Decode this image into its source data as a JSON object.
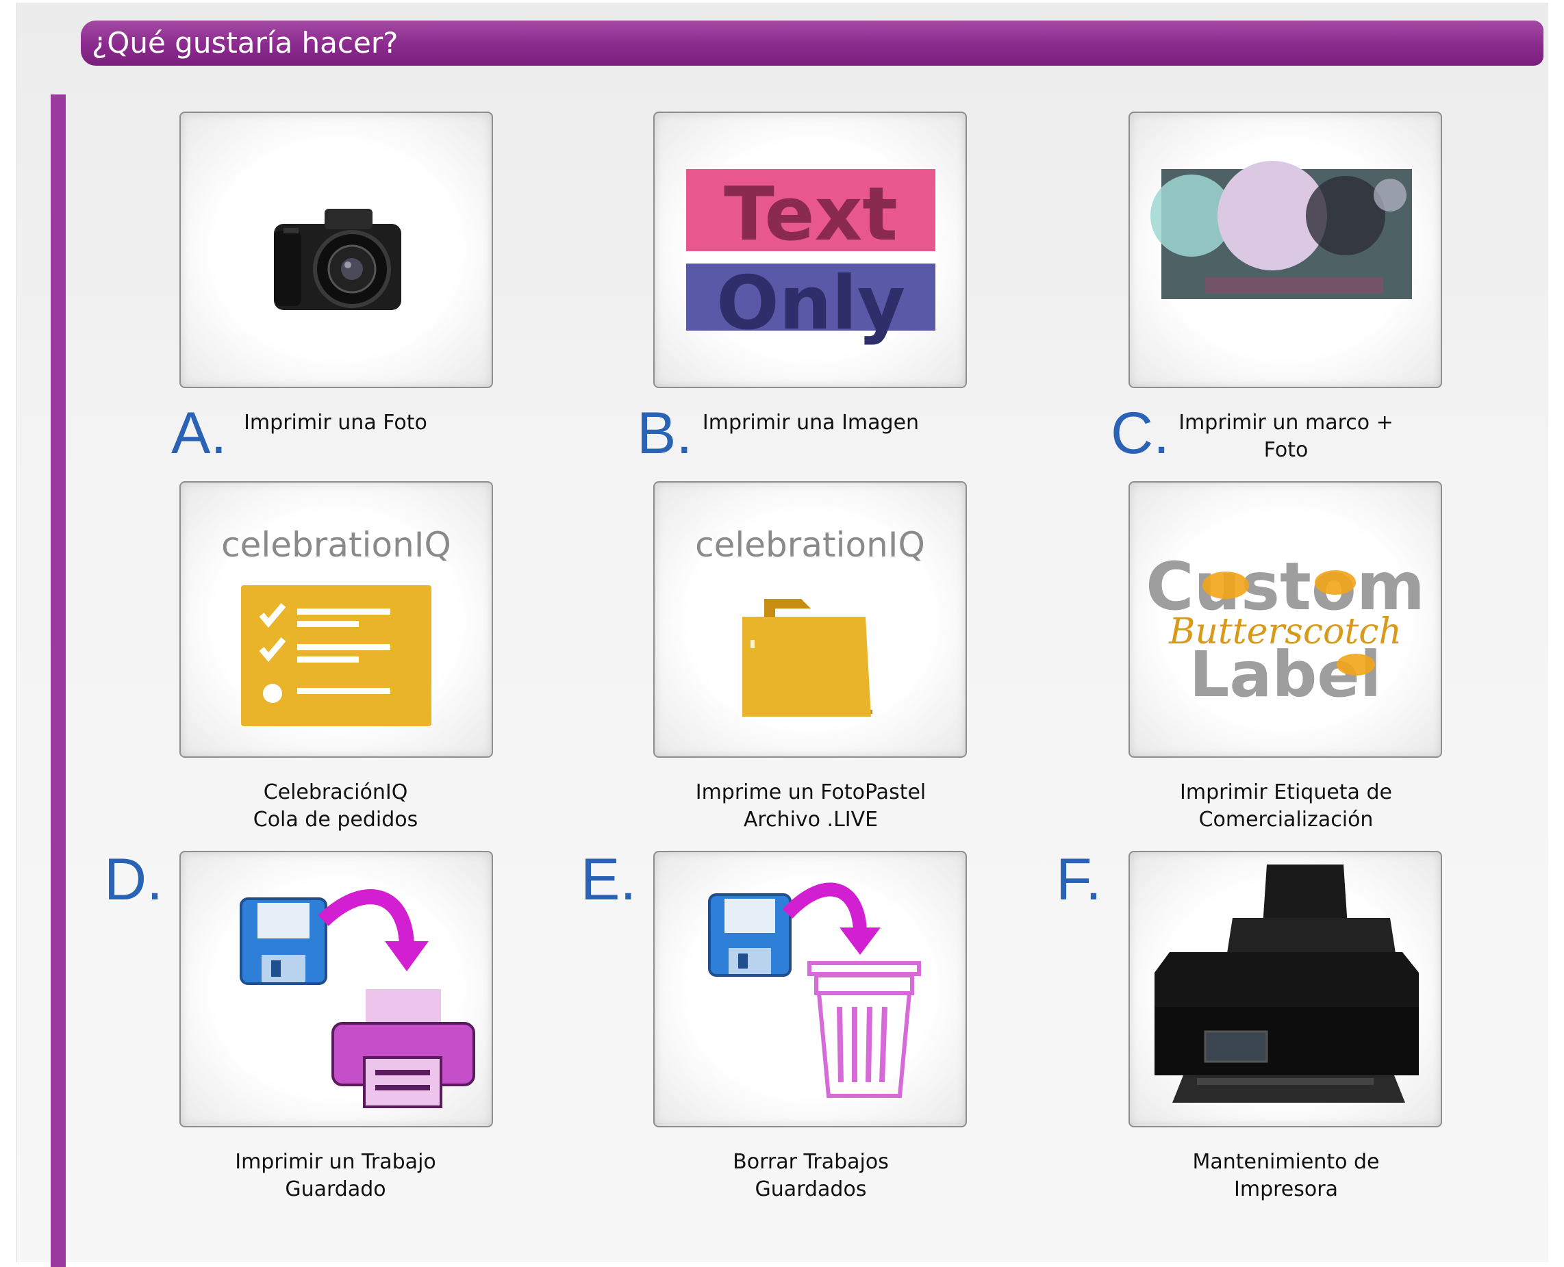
{
  "header": {
    "title": "¿Qué gustaría hacer?"
  },
  "tiles": [
    {
      "letter": "A.",
      "label": "Imprimir una Foto",
      "icon": "camera-icon"
    },
    {
      "letter": "B.",
      "label": "Imprimir una Imagen",
      "icon": "text-only-icon",
      "icon_text": [
        "Text",
        "Only"
      ]
    },
    {
      "letter": "C.",
      "label": "Imprimir un marco +\nFoto",
      "icon": "photo-frame-icon"
    },
    {
      "letter": "",
      "label": "CelebraciónIQ\nCola de pedidos",
      "icon": "checklist-icon",
      "logo_text": "celebrationIQ"
    },
    {
      "letter": "",
      "label": "Imprime un FotoPastel\nArchivo .LIVE",
      "icon": "folder-icon",
      "logo_text": "celebrationIQ"
    },
    {
      "letter": "",
      "label": "Imprimir Etiqueta de\nComercialización",
      "icon": "label-icon",
      "icon_text": [
        "Custom",
        "Butterscotch",
        "Label"
      ]
    },
    {
      "letter": "D.",
      "label": "Imprimir un Trabajo\nGuardado",
      "icon": "save-to-print-icon"
    },
    {
      "letter": "E.",
      "label": "Borrar Trabajos\nGuardados",
      "icon": "save-to-trash-icon"
    },
    {
      "letter": "F.",
      "label": "Mantenimiento de\nImpresora",
      "icon": "printer-icon"
    }
  ],
  "colors": {
    "accent": "#8b2a8e",
    "letter": "#2a63b5",
    "folder": "#e9b32a"
  }
}
